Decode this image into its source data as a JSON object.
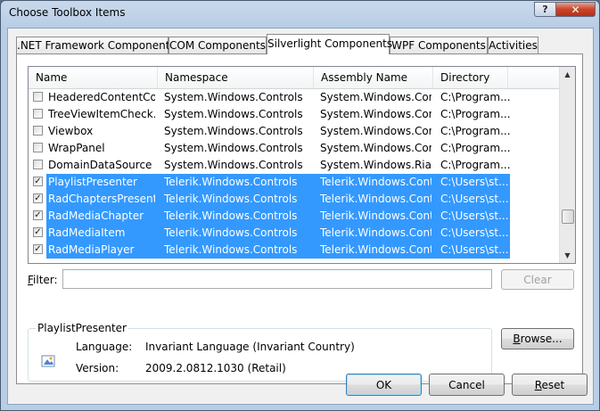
{
  "window": {
    "title": "Choose Toolbox Items",
    "help_label": "?",
    "close_label": "✕"
  },
  "tabs": [
    {
      "label": ".NET Framework Components"
    },
    {
      "label": "COM Components"
    },
    {
      "label": "Silverlight Components"
    },
    {
      "label": "WPF Components"
    },
    {
      "label": "Activities"
    }
  ],
  "list": {
    "columns": [
      "Name",
      "Namespace",
      "Assembly Name",
      "Directory"
    ],
    "rows": [
      {
        "checked": false,
        "selected": false,
        "name": "HeaderedContentCo...",
        "namespace": "System.Windows.Controls",
        "assembly": "System.Windows.Contr...",
        "directory": "C:\\Program..."
      },
      {
        "checked": false,
        "selected": false,
        "name": "TreeViewItemCheck...",
        "namespace": "System.Windows.Controls",
        "assembly": "System.Windows.Contr...",
        "directory": "C:\\Program..."
      },
      {
        "checked": false,
        "selected": false,
        "name": "Viewbox",
        "namespace": "System.Windows.Controls",
        "assembly": "System.Windows.Contr...",
        "directory": "C:\\Program..."
      },
      {
        "checked": false,
        "selected": false,
        "name": "WrapPanel",
        "namespace": "System.Windows.Controls",
        "assembly": "System.Windows.Contr...",
        "directory": "C:\\Program..."
      },
      {
        "checked": false,
        "selected": false,
        "name": "DomainDataSource",
        "namespace": "System.Windows.Controls",
        "assembly": "System.Windows.Ria....",
        "directory": "C:\\Program..."
      },
      {
        "checked": true,
        "selected": true,
        "name": "PlaylistPresenter",
        "namespace": "Telerik.Windows.Controls",
        "assembly": "Telerik.Windows.Cont...",
        "directory": "C:\\Users\\st..."
      },
      {
        "checked": true,
        "selected": true,
        "name": "RadChaptersPresenter",
        "namespace": "Telerik.Windows.Controls",
        "assembly": "Telerik.Windows.Cont...",
        "directory": "C:\\Users\\st..."
      },
      {
        "checked": true,
        "selected": true,
        "name": "RadMediaChapter",
        "namespace": "Telerik.Windows.Controls",
        "assembly": "Telerik.Windows.Cont...",
        "directory": "C:\\Users\\st..."
      },
      {
        "checked": true,
        "selected": true,
        "name": "RadMediaItem",
        "namespace": "Telerik.Windows.Controls",
        "assembly": "Telerik.Windows.Cont...",
        "directory": "C:\\Users\\st..."
      },
      {
        "checked": true,
        "selected": true,
        "name": "RadMediaPlayer",
        "namespace": "Telerik.Windows.Controls",
        "assembly": "Telerik.Windows.Cont...",
        "directory": "C:\\Users\\st..."
      }
    ]
  },
  "filter": {
    "label_accel": "F",
    "label_rest": "ilter:",
    "value": ""
  },
  "buttons": {
    "clear": "Clear",
    "browse": "Browse...",
    "browse_accel": "B",
    "browse_rest": "rowse...",
    "ok": "OK",
    "cancel": "Cancel",
    "reset_accel": "R",
    "reset_rest": "eset"
  },
  "info": {
    "title": "PlaylistPresenter",
    "language_label": "Language:",
    "language_value": "Invariant Language (Invariant Country)",
    "version_label": "Version:",
    "version_value": "2009.2.0812.1030 (Retail)",
    "icon": "component-icon"
  },
  "colors": {
    "selection": "#3399ff",
    "title_bar": "#b8cde6"
  }
}
